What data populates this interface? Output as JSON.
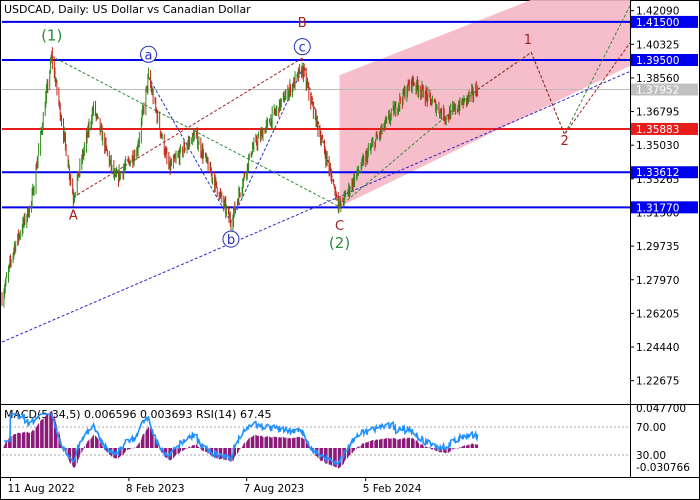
{
  "header": {
    "symbol_line": "USDCAD, Daily:  US Dollar vs Canadian Dollar"
  },
  "indicator_header": {
    "text": "MACD(5,34,5) 0.006596 0.003693 RSI(14) 67.45"
  },
  "colors": {
    "bull": "#2e8b1e",
    "bear": "#c42a1a",
    "support_resistance": "#0000ee",
    "key_level": "#e81c1c",
    "channel_fill": "#f5b7c4",
    "macd_hist": "#8b1a78",
    "rsi_line": "#1e90ff",
    "wave_primary": "#2e8b3a",
    "wave_secondary": "#2233bb",
    "wave_abc": "#a32020",
    "trendline": "#3322cc",
    "current_price_label": "#c0c0c0"
  },
  "chart_data": {
    "type": "candlestick",
    "instrument": "USDCAD",
    "timeframe": "Daily",
    "x_tick_labels": [
      "11 Aug 2022",
      "8 Feb 2023",
      "7 Aug 2023",
      "5 Feb 2024"
    ],
    "y_axis_ticks": [
      "1.42090",
      "1.40325",
      "1.38560",
      "1.36795",
      "1.35030",
      "1.33265",
      "1.31500",
      "1.29735",
      "1.27970",
      "1.26205",
      "1.24440",
      "1.22675"
    ],
    "ylim": [
      1.2145,
      1.4244
    ],
    "current_price": "1.37952",
    "horizontal_levels": [
      {
        "label": "1.41500",
        "value": 1.415,
        "kind": "resistance"
      },
      {
        "label": "1.39500",
        "value": 1.395,
        "kind": "resistance"
      },
      {
        "label": "1.35883",
        "value": 1.35883,
        "kind": "key"
      },
      {
        "label": "1.33612",
        "value": 1.33612,
        "kind": "support"
      },
      {
        "label": "1.31770",
        "value": 1.3177,
        "kind": "support"
      }
    ],
    "price_path": [
      {
        "d": "2022-07-29",
        "v": 1.27
      },
      {
        "d": "2022-08-16",
        "v": 1.296
      },
      {
        "d": "2022-09-12",
        "v": 1.32
      },
      {
        "d": "2022-10-13",
        "v": 1.397
      },
      {
        "d": "2022-11-15",
        "v": 1.323
      },
      {
        "d": "2022-12-16",
        "v": 1.37
      },
      {
        "d": "2023-01-18",
        "v": 1.332
      },
      {
        "d": "2023-02-20",
        "v": 1.347
      },
      {
        "d": "2023-03-10",
        "v": 1.386
      },
      {
        "d": "2023-04-10",
        "v": 1.338
      },
      {
        "d": "2023-05-20",
        "v": 1.356
      },
      {
        "d": "2023-07-14",
        "v": 1.31
      },
      {
        "d": "2023-08-15",
        "v": 1.348
      },
      {
        "d": "2023-10-31",
        "v": 1.39
      },
      {
        "d": "2023-12-27",
        "v": 1.318
      },
      {
        "d": "2024-02-15",
        "v": 1.35
      },
      {
        "d": "2024-04-16",
        "v": 1.384
      },
      {
        "d": "2024-06-07",
        "v": 1.365
      },
      {
        "d": "2024-07-25",
        "v": 1.3795
      }
    ],
    "wave_labels": [
      {
        "text": "(1)",
        "d": "2022-10-13",
        "v": 1.408,
        "style": "primary"
      },
      {
        "text": "(2)",
        "d": "2023-12-27",
        "v": 1.299,
        "style": "primary"
      },
      {
        "text": "a",
        "d": "2023-03-10",
        "v": 1.398,
        "style": "circled"
      },
      {
        "text": "b",
        "d": "2023-07-14",
        "v": 1.301,
        "style": "circled"
      },
      {
        "text": "c",
        "d": "2023-10-31",
        "v": 1.402,
        "style": "circled"
      },
      {
        "text": "A",
        "d": "2022-11-15",
        "v": 1.314,
        "style": "abc"
      },
      {
        "text": "B",
        "d": "2023-10-31",
        "v": 1.415,
        "style": "abc"
      },
      {
        "text": "C",
        "d": "2023-12-27",
        "v": 1.3085,
        "style": "abc"
      },
      {
        "text": "1",
        "d": "2024-10-10",
        "v": 1.406,
        "style": "abc"
      },
      {
        "text": "2",
        "d": "2024-12-05",
        "v": 1.353,
        "style": "abc"
      }
    ],
    "projection": [
      {
        "d": "2024-07-25",
        "v": 1.3795
      },
      {
        "d": "2024-10-15",
        "v": 1.399
      },
      {
        "d": "2024-12-05",
        "v": 1.356
      },
      {
        "d": "2025-03-15",
        "v": 1.4235
      }
    ],
    "channel": {
      "start": "2023-12-27",
      "end": "2025-03-15",
      "lower": [
        1.318,
        1.392
      ],
      "upper": [
        1.387,
        1.447
      ]
    },
    "trendline": {
      "start": "2022-07-29",
      "end": "2025-03-15",
      "from": 1.247,
      "to": 1.389
    },
    "indicator": {
      "macd_axis_ticks": [
        "0.047700",
        "-0.030766"
      ],
      "rsi_levels": [
        "70.00",
        "30.00"
      ],
      "rsi_value": "67.45",
      "macd_values": [
        0.006596,
        0.003693
      ]
    }
  }
}
